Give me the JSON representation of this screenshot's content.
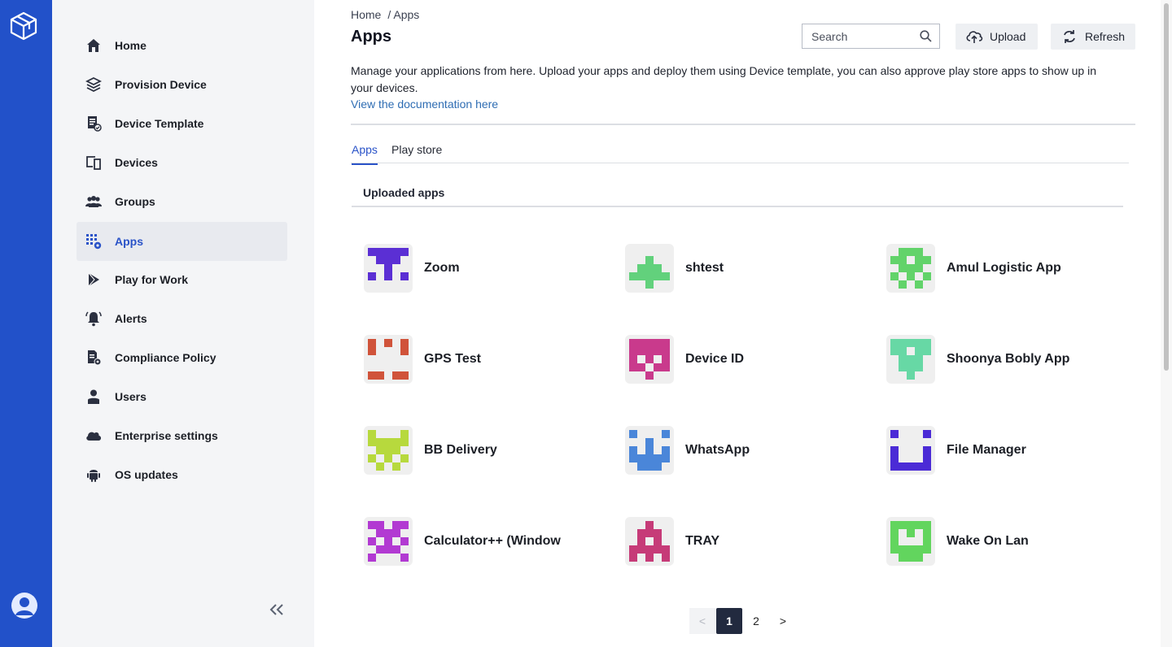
{
  "breadcrumb": {
    "home": "Home",
    "current": "/ Apps"
  },
  "page": {
    "title": "Apps",
    "description": "Manage your applications from here. Upload your apps and deploy them using Device template, you can also approve play store apps to show up in your devices.",
    "doc_link": "View the documentation here"
  },
  "search": {
    "placeholder": "Search"
  },
  "toolbar": {
    "upload_label": "Upload",
    "refresh_label": "Refresh"
  },
  "sidebar": {
    "items": [
      {
        "label": "Home",
        "icon": "home-icon"
      },
      {
        "label": "Provision Device",
        "icon": "stack-icon"
      },
      {
        "label": "Device Template",
        "icon": "template-icon"
      },
      {
        "label": "Devices",
        "icon": "devices-icon"
      },
      {
        "label": "Groups",
        "icon": "groups-icon"
      },
      {
        "label": "Apps",
        "icon": "apps-grid-icon",
        "active": true
      },
      {
        "label": "Play for Work",
        "icon": "play-icon"
      },
      {
        "label": "Alerts",
        "icon": "bell-icon"
      },
      {
        "label": "Compliance Policy",
        "icon": "policy-icon"
      },
      {
        "label": "Users",
        "icon": "user-icon"
      },
      {
        "label": "Enterprise settings",
        "icon": "cloud-icon"
      },
      {
        "label": "OS updates",
        "icon": "android-icon"
      }
    ]
  },
  "tabs": [
    {
      "label": "Apps",
      "active": true
    },
    {
      "label": "Play store",
      "active": false
    }
  ],
  "section": {
    "title": "Uploaded apps"
  },
  "apps": [
    {
      "name": "Zoom",
      "color": "#5b2fd4"
    },
    {
      "name": "shtest",
      "color": "#62d17c"
    },
    {
      "name": "Amul Logistic App",
      "color": "#62d36a"
    },
    {
      "name": "GPS Test",
      "color": "#d0533a"
    },
    {
      "name": "Device ID",
      "color": "#c93a8c"
    },
    {
      "name": "Shoonya Bobly App",
      "color": "#67d8a5"
    },
    {
      "name": "BB Delivery",
      "color": "#b7d93d"
    },
    {
      "name": "WhatsApp",
      "color": "#4a86d9"
    },
    {
      "name": "File Manager",
      "color": "#4b2bd6"
    },
    {
      "name": "Calculator++ (Window",
      "color": "#b23ad2"
    },
    {
      "name": "TRAY",
      "color": "#c63b78"
    },
    {
      "name": "Wake On Lan",
      "color": "#62d55e"
    }
  ],
  "pagination": {
    "prev": "<",
    "pages": [
      "1",
      "2"
    ],
    "current": "1",
    "next": ">"
  },
  "colors": {
    "rail": "#2251c9",
    "accent": "#2a53c8",
    "sidebar_bg": "#f4f5f7"
  }
}
